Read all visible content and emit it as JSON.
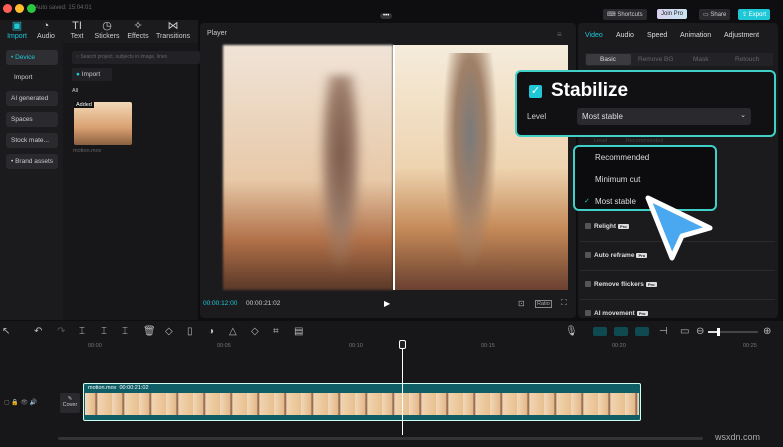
{
  "titlebar": {
    "autosave": "Auto saved: 15:04:01",
    "more": "•••"
  },
  "toolbar_tabs": [
    {
      "label": "Import",
      "icon": "▣"
    },
    {
      "label": "Audio",
      "icon": "◔"
    },
    {
      "label": "Text",
      "icon": "TI"
    },
    {
      "label": "Stickers",
      "icon": "◷"
    },
    {
      "label": "Effects",
      "icon": "✧"
    },
    {
      "label": "Transitions",
      "icon": "⋈"
    }
  ],
  "sidebar": [
    "• Device",
    "Import",
    "AI generated",
    "Spaces",
    "Stock mate...",
    "• Brand assets"
  ],
  "media": {
    "search_placeholder": "Search project, subjects in image, lines",
    "import": "Import",
    "section": "All",
    "clip_badge": "Added",
    "clip_name": "motion.mov"
  },
  "player": {
    "title": "Player",
    "current_time": "00:00:12:00",
    "total_time": "00:00:21:02",
    "ratio": "Ratio"
  },
  "top_right": {
    "shortcuts": "Shortcuts",
    "join_pro": "Join Pro",
    "share": "Share",
    "export": "Export"
  },
  "right_tabs": [
    "Video",
    "Audio",
    "Speed",
    "Animation",
    "Adjustment"
  ],
  "sub_tabs": [
    "Basic",
    "Remove BG",
    "Mask",
    "Retouch"
  ],
  "behind": {
    "level": "Level",
    "value": "Recommended"
  },
  "stabilize": {
    "title": "Stabilize",
    "level_label": "Level",
    "level_value": "Most stable"
  },
  "dropdown": {
    "options": [
      "Recommended",
      "Minimum cut",
      "Most stable"
    ],
    "selected": "Most stable"
  },
  "features": [
    {
      "label": "Relight",
      "badge": "Pro"
    },
    {
      "label": "Auto reframe",
      "badge": "Pro"
    },
    {
      "label": "Remove flickers",
      "badge": "Pro"
    },
    {
      "label": "AI movement",
      "badge": "Pro"
    }
  ],
  "timeline": {
    "ticks": [
      "00:00",
      "00:05",
      "00:10",
      "00:15",
      "00:20",
      "00:25"
    ],
    "clip_name": "motion.mov",
    "clip_duration": "00:00:21:02",
    "cover": "Cover",
    "playhead_fraction": 0.48
  },
  "watermark": "wsxdn.com",
  "colors": {
    "accent": "#1fc8d6",
    "cursor": "#4aa8f0",
    "clip": "#0f5e66"
  }
}
